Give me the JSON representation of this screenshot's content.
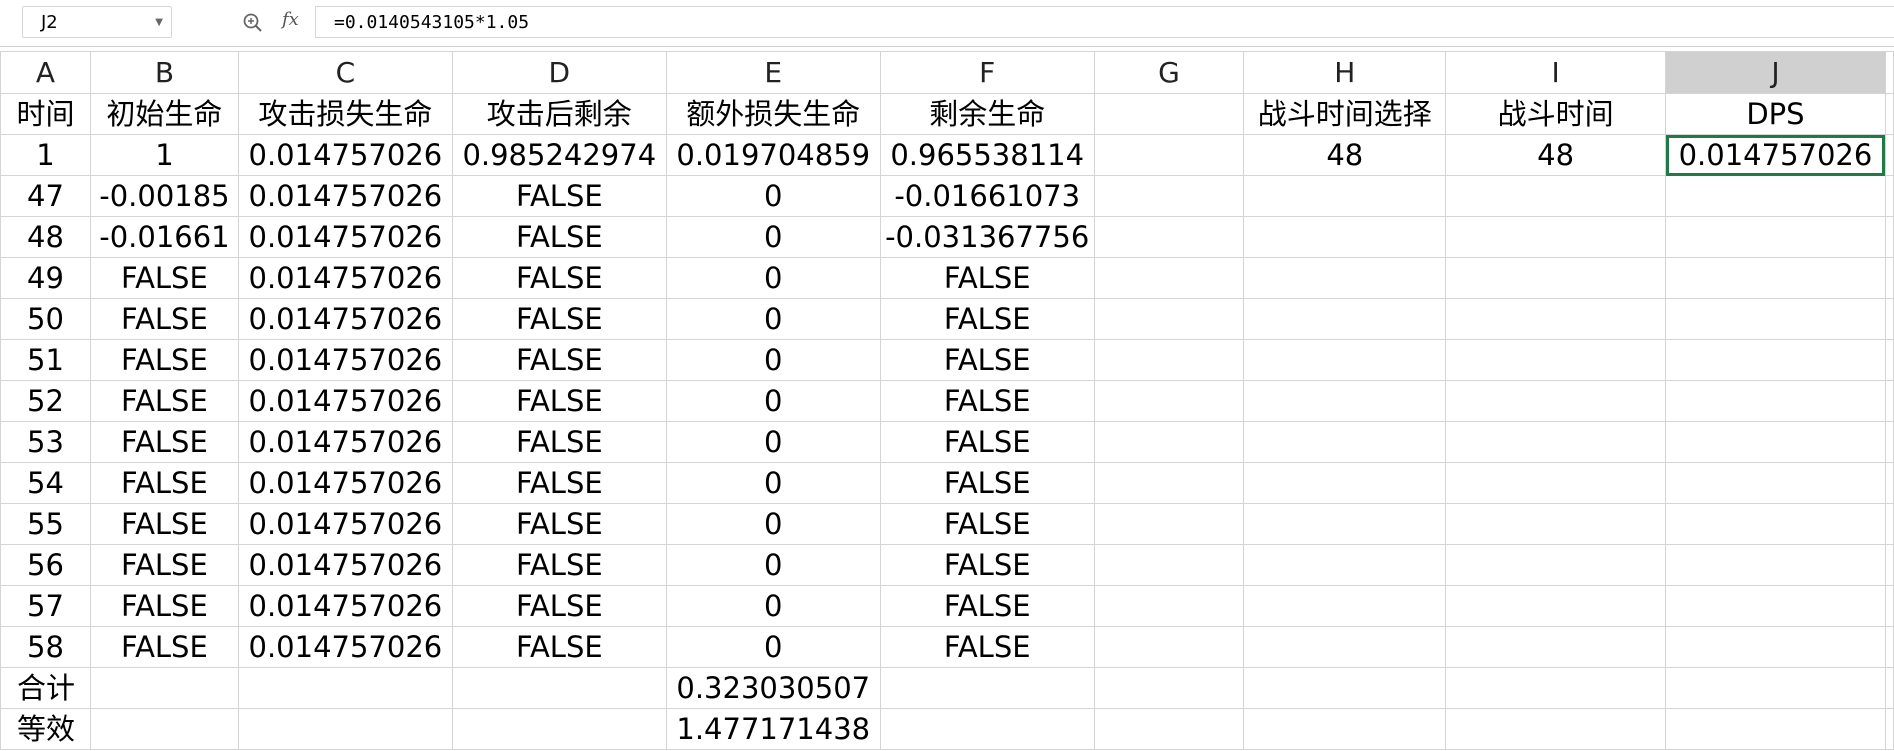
{
  "formula_bar": {
    "name_box": "J2",
    "fx_label": "fx",
    "formula": "=0.0140543105*1.05"
  },
  "columns": [
    "A",
    "B",
    "C",
    "D",
    "E",
    "F",
    "G",
    "H",
    "I",
    "J"
  ],
  "selected_column": "J",
  "rows": [
    [
      "时间",
      "初始生命",
      "攻击损失生命",
      "攻击后剩余",
      "额外损失生命",
      "剩余生命",
      "",
      "战斗时间选择",
      "战斗时间",
      "DPS"
    ],
    [
      "1",
      "1",
      "0.014757026",
      "0.985242974",
      "0.019704859",
      "0.965538114",
      "",
      "48",
      "48",
      "0.014757026"
    ],
    [
      "47",
      "-0.00185",
      "0.014757026",
      "FALSE",
      "0",
      "-0.01661073",
      "",
      "",
      "",
      ""
    ],
    [
      "48",
      "-0.01661",
      "0.014757026",
      "FALSE",
      "0",
      "-0.031367756",
      "",
      "",
      "",
      ""
    ],
    [
      "49",
      "FALSE",
      "0.014757026",
      "FALSE",
      "0",
      "FALSE",
      "",
      "",
      "",
      ""
    ],
    [
      "50",
      "FALSE",
      "0.014757026",
      "FALSE",
      "0",
      "FALSE",
      "",
      "",
      "",
      ""
    ],
    [
      "51",
      "FALSE",
      "0.014757026",
      "FALSE",
      "0",
      "FALSE",
      "",
      "",
      "",
      ""
    ],
    [
      "52",
      "FALSE",
      "0.014757026",
      "FALSE",
      "0",
      "FALSE",
      "",
      "",
      "",
      ""
    ],
    [
      "53",
      "FALSE",
      "0.014757026",
      "FALSE",
      "0",
      "FALSE",
      "",
      "",
      "",
      ""
    ],
    [
      "54",
      "FALSE",
      "0.014757026",
      "FALSE",
      "0",
      "FALSE",
      "",
      "",
      "",
      ""
    ],
    [
      "55",
      "FALSE",
      "0.014757026",
      "FALSE",
      "0",
      "FALSE",
      "",
      "",
      "",
      ""
    ],
    [
      "56",
      "FALSE",
      "0.014757026",
      "FALSE",
      "0",
      "FALSE",
      "",
      "",
      "",
      ""
    ],
    [
      "57",
      "FALSE",
      "0.014757026",
      "FALSE",
      "0",
      "FALSE",
      "",
      "",
      "",
      ""
    ],
    [
      "58",
      "FALSE",
      "0.014757026",
      "FALSE",
      "0",
      "FALSE",
      "",
      "",
      "",
      ""
    ],
    [
      "合计",
      "",
      "",
      "",
      "0.323030507",
      "",
      "",
      "",
      "",
      ""
    ],
    [
      "等效",
      "",
      "",
      "",
      "1.477171438",
      "",
      "",
      "",
      "",
      ""
    ]
  ],
  "highlights": {
    "yellow_cell": "F48",
    "red_cell": "F58",
    "active_cell": "J2",
    "colors": {
      "yellow": "#ffff00",
      "red": "#ff0000",
      "active_border": "#1f7a47"
    }
  },
  "icons": [
    "zoom-icon",
    "dropdown-arrow-icon"
  ]
}
